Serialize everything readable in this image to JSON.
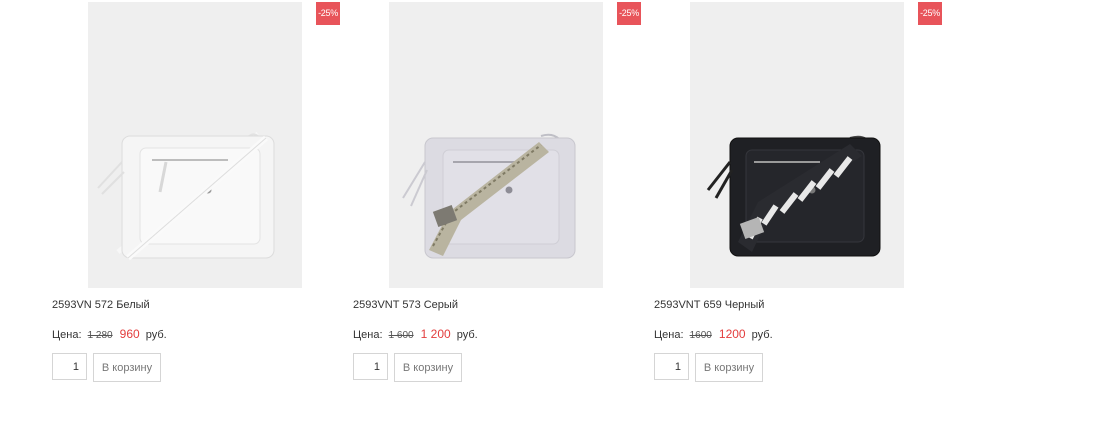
{
  "products": [
    {
      "discount": "-25%",
      "name": "2593VN 572 Белый",
      "price_label": "Цена:",
      "old_price": "1 280",
      "new_price": "960",
      "currency": "руб.",
      "qty": "1",
      "cart_label": "В корзину",
      "bag_color": "white"
    },
    {
      "discount": "-25%",
      "name": "2593VNT 573 Серый",
      "price_label": "Цена:",
      "old_price": "1 600",
      "new_price": "1 200",
      "currency": "руб.",
      "qty": "1",
      "cart_label": "В корзину",
      "bag_color": "grey"
    },
    {
      "discount": "-25%",
      "name": "2593VNT 659 Черный",
      "price_label": "Цена:",
      "old_price": "1600",
      "new_price": "1200",
      "currency": "руб.",
      "qty": "1",
      "cart_label": "В корзину",
      "bag_color": "black"
    }
  ],
  "colors": {
    "badge": "#e8545a",
    "new_price": "#e33d3d",
    "photo_bg": "#efefef",
    "border": "#d5d5d5"
  }
}
